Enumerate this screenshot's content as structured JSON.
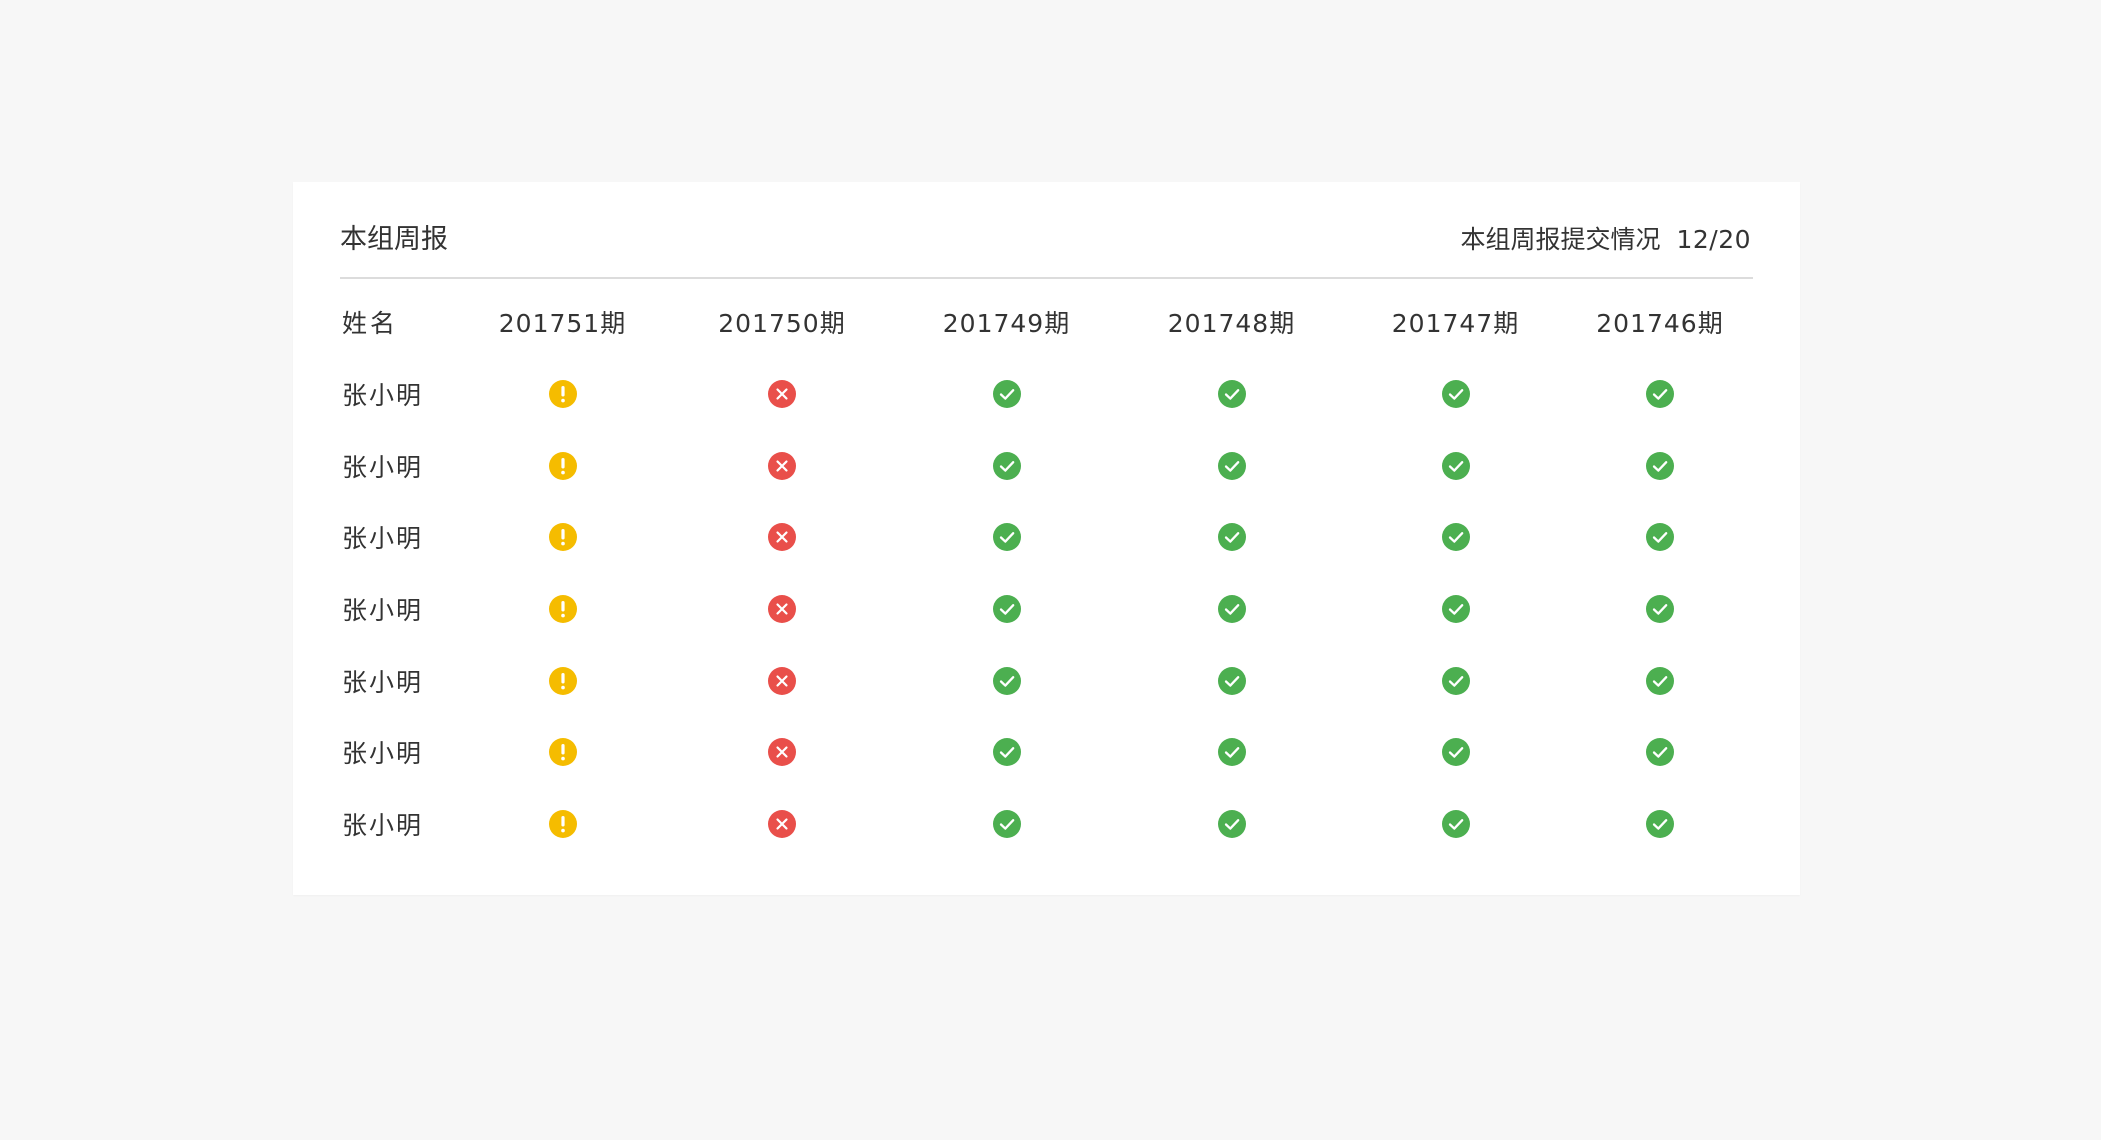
{
  "report": {
    "title": "本组周报",
    "summary_label": "本组周报提交情况",
    "summary_count": "12/20"
  },
  "table": {
    "name_header": "姓名",
    "periods": [
      "201751期",
      "201750期",
      "201749期",
      "201748期",
      "201747期",
      "201746期"
    ],
    "rows": [
      {
        "name": "张小明",
        "statuses": [
          "warning",
          "rejected",
          "submitted",
          "submitted",
          "submitted",
          "submitted"
        ]
      },
      {
        "name": "张小明",
        "statuses": [
          "warning",
          "rejected",
          "submitted",
          "submitted",
          "submitted",
          "submitted"
        ]
      },
      {
        "name": "张小明",
        "statuses": [
          "warning",
          "rejected",
          "submitted",
          "submitted",
          "submitted",
          "submitted"
        ]
      },
      {
        "name": "张小明",
        "statuses": [
          "warning",
          "rejected",
          "submitted",
          "submitted",
          "submitted",
          "submitted"
        ]
      },
      {
        "name": "张小明",
        "statuses": [
          "warning",
          "rejected",
          "submitted",
          "submitted",
          "submitted",
          "submitted"
        ]
      },
      {
        "name": "张小明",
        "statuses": [
          "warning",
          "rejected",
          "submitted",
          "submitted",
          "submitted",
          "submitted"
        ]
      },
      {
        "name": "张小明",
        "statuses": [
          "warning",
          "rejected",
          "submitted",
          "submitted",
          "submitted",
          "submitted"
        ]
      }
    ]
  },
  "status_icons": {
    "warning": {
      "icon": "exclamation-circle-icon",
      "color": "#f5bc00"
    },
    "rejected": {
      "icon": "close-circle-icon",
      "color": "#e94f4a"
    },
    "submitted": {
      "icon": "check-circle-icon",
      "color": "#4caf50"
    }
  },
  "colors": {
    "page_background": "#f7f7f7",
    "card_background": "#ffffff",
    "divider": "#dcdcdc",
    "text": "#333333"
  }
}
